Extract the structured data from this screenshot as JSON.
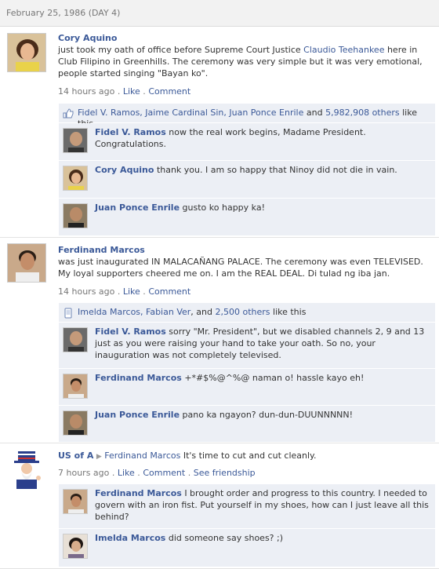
{
  "date_header": "February 25, 1986 (DAY 4)",
  "posts": [
    {
      "author": "Cory Aquino",
      "text_before": "just took my oath of office before Supreme Court Justice ",
      "text_link": "Claudio Teehankee",
      "text_after": " here in Club Filipino in Greenhills. The ceremony was very simple but it was very emotional, people started singing \"Bayan ko\".",
      "time": "14 hours ago",
      "like_label": "Like",
      "comment_label": "Comment",
      "likes": {
        "names": "Fidel V. Ramos, Jaime Cardinal Sin, Juan Ponce Enrile",
        "and": " and ",
        "others": "5,982,908 others",
        "suffix": " like this"
      },
      "comments": [
        {
          "author": "Fidel V. Ramos",
          "text": "now the real work begins, Madame President. Congratulations."
        },
        {
          "author": "Cory Aquino",
          "text": "thank you. I am so happy that Ninoy did not die in vain."
        },
        {
          "author": "Juan Ponce Enrile",
          "text": "gusto ko happy ka!"
        }
      ]
    },
    {
      "author": "Ferdinand Marcos",
      "text": "was just inaugurated IN MALACAÑANG PALACE. The ceremony was even TELEVISED. My loyal supporters cheered me on. I am the REAL DEAL. Di tulad ng iba jan.",
      "time": "14 hours ago",
      "like_label": "Like",
      "comment_label": "Comment",
      "likes": {
        "names": "Imelda Marcos, Fabian Ver",
        "and": ", and ",
        "others": "2,500 others",
        "suffix": " like this"
      },
      "comments": [
        {
          "author": "Fidel V. Ramos",
          "text": "sorry \"Mr. President\", but we disabled channels 2, 9 and 13 just as you were raising your hand to take your oath. So no, your inauguration was not completely televised."
        },
        {
          "author": "Ferdinand Marcos",
          "text": "+*#$%@^%@ naman o! hassle kayo eh!"
        },
        {
          "author": "Juan Ponce Enrile",
          "text": "pano ka ngayon? dun-dun-DUUNNNNN!"
        }
      ]
    },
    {
      "author": "US of A",
      "target": "Ferdinand Marcos",
      "text": "It's time to cut and cut cleanly.",
      "time": "7 hours ago",
      "like_label": "Like",
      "comment_label": "Comment",
      "friendship_label": "See friendship",
      "comments": [
        {
          "author": "Ferdinand Marcos",
          "text": "I brought order and progress to this country. I needed to govern with an iron fist. Put yourself in my shoes, how can I just leave all this behind?"
        },
        {
          "author": "Imelda Marcos",
          "text": "did someone say shoes? ;)"
        }
      ]
    }
  ],
  "colors": {
    "link": "#3b5998",
    "comment_bg": "#eceff5",
    "meta": "#777777"
  }
}
